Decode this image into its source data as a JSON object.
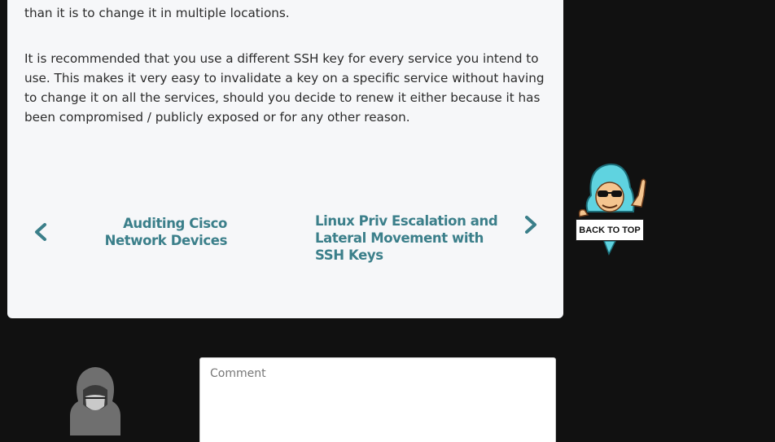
{
  "article": {
    "paragraphs": [
      "If a keypair becomes compromised, it is much easier to regenerate one keypair than it is to change it in multiple locations.",
      "It is recommended that you use a different SSH key for every service you intend to use. This makes it very easy to invalidate a key on a specific service without having to change it on all the services, should you decide to renew it either because it has been compromised / publicly exposed or for any other reason."
    ]
  },
  "post_nav": {
    "previous_title": "Auditing Cisco Network Devices",
    "next_title": "Linux Priv Escalation and Lateral Movement with SSH Keys"
  },
  "back_to_top": {
    "label": "BACK TO TOP"
  },
  "comment": {
    "placeholder": "Comment",
    "value": ""
  },
  "colors": {
    "page_bg": "#111111",
    "card_bg": "#f6f7f9",
    "link_accent": "#3b7f8a",
    "hoodie_cyan": "#5fd3e0"
  },
  "icons": {
    "prev": "chevron-left-icon",
    "next": "chevron-right-icon",
    "mascot": "hacker-mascot-icon",
    "avatar": "hooded-user-avatar-icon"
  }
}
